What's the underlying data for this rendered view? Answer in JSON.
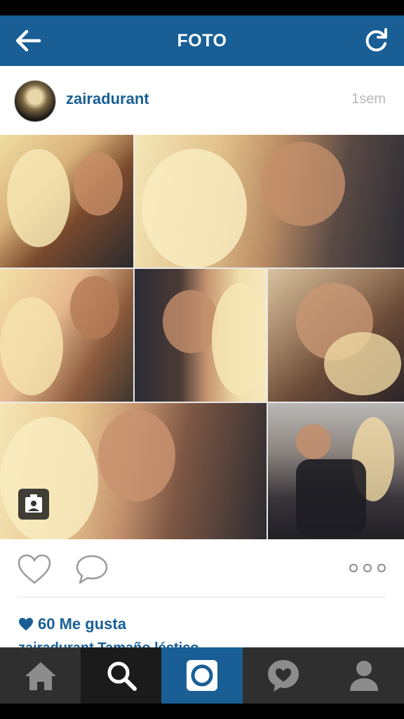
{
  "nav": {
    "title": "FOTO",
    "back_icon": "back-arrow-icon",
    "refresh_icon": "refresh-icon"
  },
  "post": {
    "username": "zairadurant",
    "timestamp": "1sem",
    "likes": "60 Me gusta",
    "caption_peek": "zairadurant Tamaño léctico..."
  },
  "tabs": [
    {
      "name": "home",
      "icon": "home-icon"
    },
    {
      "name": "search",
      "icon": "search-icon"
    },
    {
      "name": "camera",
      "icon": "camera-icon"
    },
    {
      "name": "activity",
      "icon": "heart-bubble-icon"
    },
    {
      "name": "profile",
      "icon": "profile-icon"
    }
  ],
  "colors": {
    "brand": "#195f95",
    "active_tab": "#195f95",
    "tab_bar": "#2f2f2f"
  }
}
